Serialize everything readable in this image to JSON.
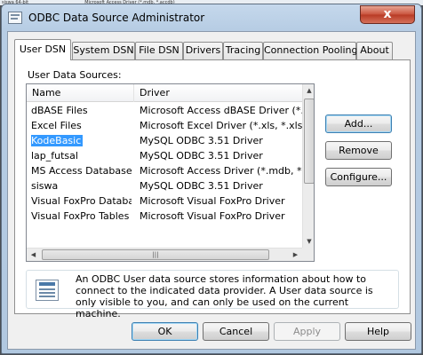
{
  "window": {
    "title": "ODBC Data Source Administrator",
    "close_glyph": "x"
  },
  "tabs": [
    {
      "label": "User DSN",
      "active": true
    },
    {
      "label": "System DSN",
      "active": false
    },
    {
      "label": "File DSN",
      "active": false
    },
    {
      "label": "Drivers",
      "active": false
    },
    {
      "label": "Tracing",
      "active": false
    },
    {
      "label": "Connection Pooling",
      "active": false
    },
    {
      "label": "About",
      "active": false
    }
  ],
  "panel": {
    "section_label": "User Data Sources:",
    "columns": {
      "name": "Name",
      "driver": "Driver"
    },
    "rows": [
      {
        "name": "dBASE Files",
        "driver": "Microsoft Access dBASE Driver (*.dbf,"
      },
      {
        "name": "Excel Files",
        "driver": "Microsoft Excel Driver (*.xls, *.xlsx, *.xls"
      },
      {
        "name": "KodeBasic",
        "driver": "MySQL ODBC 3.51 Driver",
        "selected": true
      },
      {
        "name": "lap_futsal",
        "driver": "MySQL ODBC 3.51 Driver"
      },
      {
        "name": "MS Access Database",
        "driver": "Microsoft Access Driver (*.mdb, *.accd"
      },
      {
        "name": "siswa",
        "driver": "MySQL ODBC 3.51 Driver"
      },
      {
        "name": "Visual FoxPro Database",
        "driver": "Microsoft Visual FoxPro Driver"
      },
      {
        "name": "Visual FoxPro Tables",
        "driver": "Microsoft Visual FoxPro Driver"
      }
    ],
    "buttons": {
      "add": "Add...",
      "remove": "Remove",
      "configure": "Configure..."
    },
    "scrollbar": {
      "up": "▲",
      "down": "▼",
      "left": "◀",
      "right": "▶",
      "grip": "|||"
    },
    "info_text": "An ODBC User data source stores information about how to connect to the indicated data provider.   A User data source is only visible to you, and can only be used on the current machine."
  },
  "footer": {
    "ok": "OK",
    "cancel": "Cancel",
    "apply": "Apply",
    "help": "Help"
  },
  "top_strip": {
    "left": "siswa  64-bit",
    "right": "Microsoft Access Driver (*.mdb, *.accdb)"
  }
}
